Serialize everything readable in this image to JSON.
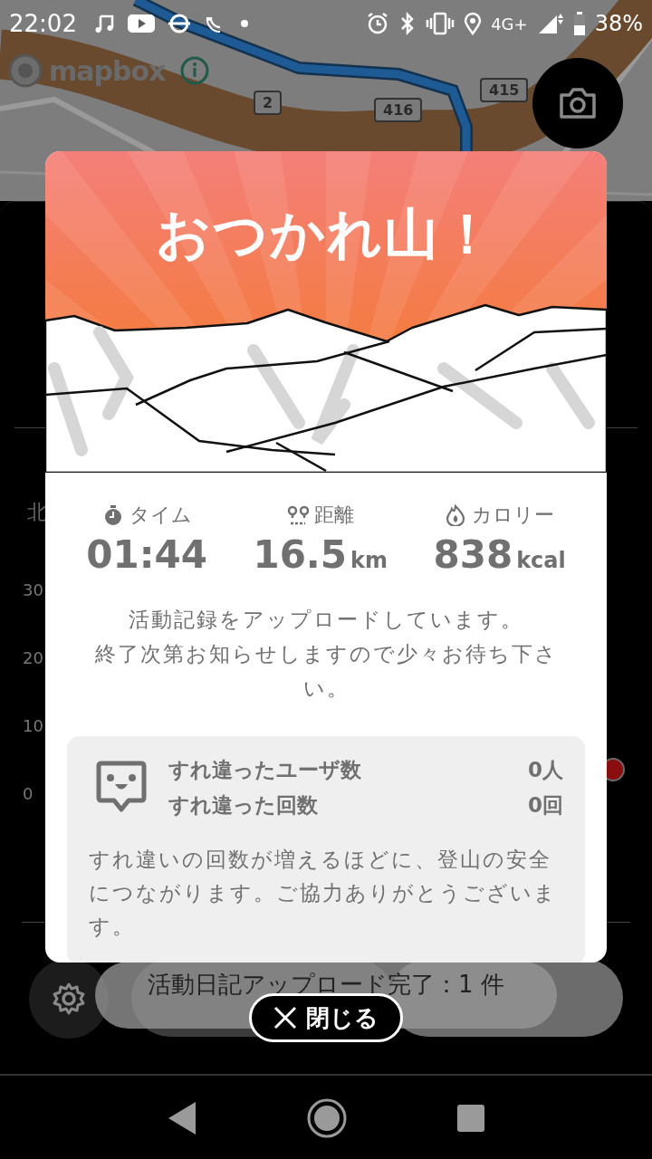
{
  "status_bar": {
    "time": "22:02",
    "network": "4G+",
    "battery": "38%"
  },
  "map": {
    "attribution": "mapbox",
    "road_labels": [
      "2",
      "416",
      "415"
    ]
  },
  "background_panel": {
    "section_label": "北",
    "y_axis_labels": [
      "30",
      "20",
      "10",
      "0"
    ]
  },
  "modal": {
    "title": "おつかれ山！",
    "stats": [
      {
        "kind": "time",
        "label": "タイム",
        "value": "01:44"
      },
      {
        "kind": "distance",
        "label": "距離",
        "value": "16.5",
        "unit": "km"
      },
      {
        "kind": "calories",
        "label": "カロリー",
        "value": "838",
        "unit": "kcal"
      }
    ],
    "message_lines": [
      "活動記録をアップロードしています。",
      "終了次第お知らせしますので少々お待ち下さい。"
    ],
    "encounters": {
      "rows": [
        {
          "label": "すれ違ったユーザ数",
          "value": "0人"
        },
        {
          "label": "すれ違った回数",
          "value": "0回"
        }
      ],
      "note": "すれ違いの回数が増えるほどに、登山の安全につながります。ご協力ありがとうございます。"
    }
  },
  "toast": "活動日記アップロード完了：1 件",
  "close_button": "閉じる"
}
